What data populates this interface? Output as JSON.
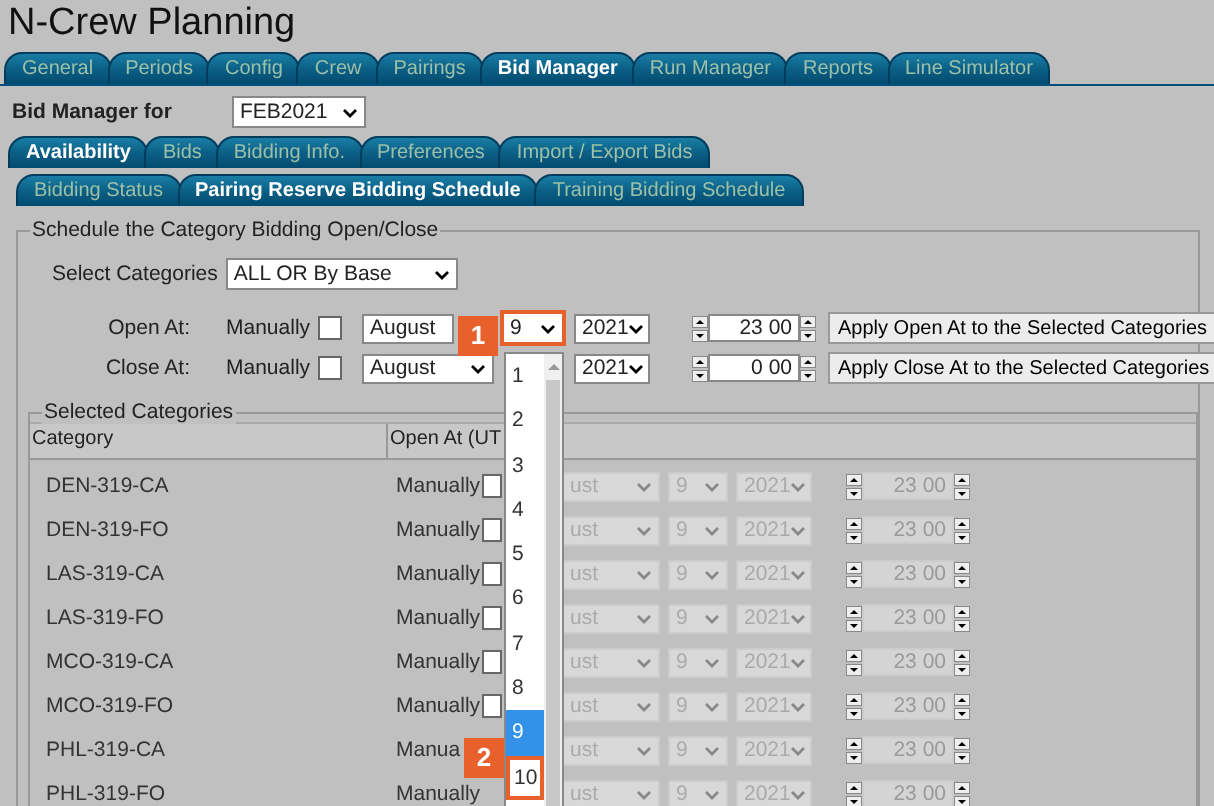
{
  "app_title": "N-Crew Planning",
  "main_tabs": [
    {
      "label": "General",
      "selected": false
    },
    {
      "label": "Periods",
      "selected": false
    },
    {
      "label": "Config",
      "selected": false
    },
    {
      "label": "Crew",
      "selected": false
    },
    {
      "label": "Pairings",
      "selected": false
    },
    {
      "label": "Bid Manager",
      "selected": true
    },
    {
      "label": "Run Manager",
      "selected": false
    },
    {
      "label": "Reports",
      "selected": false
    },
    {
      "label": "Line Simulator",
      "selected": false
    }
  ],
  "bid_manager_for": {
    "label": "Bid Manager for",
    "value": "FEB2021"
  },
  "sub_tabs": [
    {
      "label": "Availability",
      "selected": true
    },
    {
      "label": "Bids",
      "selected": false
    },
    {
      "label": "Bidding Info.",
      "selected": false
    },
    {
      "label": "Preferences",
      "selected": false
    },
    {
      "label": "Import / Export Bids",
      "selected": false
    }
  ],
  "schedule_tabs": [
    {
      "label": "Bidding Status",
      "selected": false
    },
    {
      "label": "Pairing Reserve Bidding Schedule",
      "selected": true
    },
    {
      "label": "Training Bidding Schedule",
      "selected": false
    }
  ],
  "schedule_panel": {
    "legend": "Schedule the Category Bidding Open/Close",
    "select_label": "Select Categories",
    "select_value": "ALL OR By Base",
    "rows": [
      {
        "label": "Open At:",
        "mode": "Manually",
        "checked": false,
        "month": "August",
        "day": "9",
        "day_callout": "1",
        "year": "2021",
        "hour": "23",
        "minute": "00",
        "button": "Apply Open At to the Selected Categories"
      },
      {
        "label": "Close At:",
        "mode": "Manually",
        "checked": false,
        "month": "August",
        "year": "2021",
        "hour": "0",
        "minute": "00",
        "button": "Apply Close At to the Selected Categories"
      }
    ]
  },
  "categories_panel": {
    "legend": "Selected Categories",
    "columns": [
      "Category",
      "Open At  (UT"
    ],
    "rows": [
      {
        "category": "DEN-319-CA",
        "mode": "Manually",
        "checked": false,
        "month": "ust",
        "day": "9",
        "year": "2021",
        "hour": "23",
        "minute": "00"
      },
      {
        "category": "DEN-319-FO",
        "mode": "Manually",
        "checked": false,
        "month": "ust",
        "day": "9",
        "year": "2021",
        "hour": "23",
        "minute": "00"
      },
      {
        "category": "LAS-319-CA",
        "mode": "Manually",
        "checked": false,
        "month": "ust",
        "day": "9",
        "year": "2021",
        "hour": "23",
        "minute": "00"
      },
      {
        "category": "LAS-319-FO",
        "mode": "Manually",
        "checked": false,
        "month": "ust",
        "day": "9",
        "year": "2021",
        "hour": "23",
        "minute": "00"
      },
      {
        "category": "MCO-319-CA",
        "mode": "Manually",
        "checked": false,
        "month": "ust",
        "day": "9",
        "year": "2021",
        "hour": "23",
        "minute": "00"
      },
      {
        "category": "MCO-319-FO",
        "mode": "Manually",
        "checked": false,
        "month": "ust",
        "day": "9",
        "year": "2021",
        "hour": "23",
        "minute": "00"
      },
      {
        "category": "PHL-319-CA",
        "mode": "Manua",
        "month": "ust",
        "day": "9",
        "year": "2021",
        "hour": "23",
        "minute": "00"
      },
      {
        "category": "PHL-319-FO",
        "mode": "Manually",
        "month": "ust",
        "day": "9",
        "year": "2021",
        "hour": "23",
        "minute": "00"
      }
    ]
  },
  "day_dropdown": {
    "options": [
      {
        "label": "1",
        "selected": false
      },
      {
        "label": "2",
        "selected": false
      },
      {
        "label": "3",
        "selected": false
      },
      {
        "label": "4",
        "selected": false
      },
      {
        "label": "5",
        "selected": false
      },
      {
        "label": "6",
        "selected": false
      },
      {
        "label": "7",
        "selected": false
      },
      {
        "label": "8",
        "selected": false
      },
      {
        "label": "9",
        "selected": true
      },
      {
        "label": "10",
        "selected": false,
        "callout": "2"
      }
    ]
  }
}
